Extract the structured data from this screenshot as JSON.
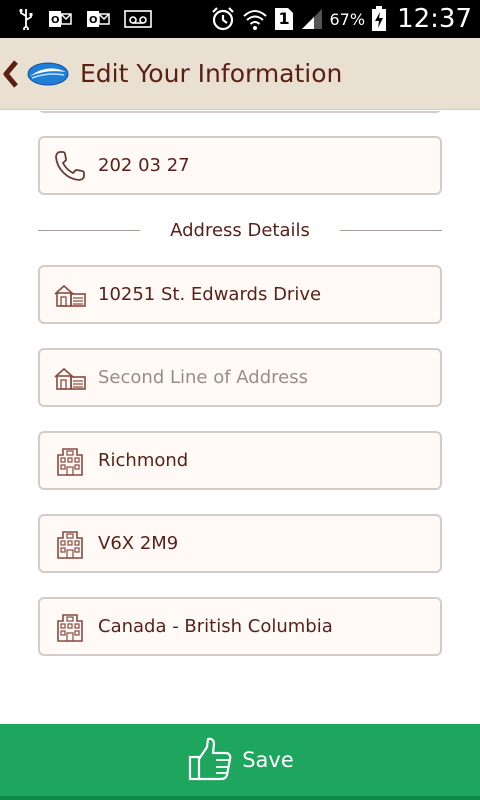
{
  "status_bar": {
    "battery": "67%",
    "time": "12:37",
    "sim_slot": "1",
    "icons": [
      "usb-icon",
      "outlook-icon",
      "outlook-icon",
      "voicemail-icon",
      "alarm-icon",
      "wifi-icon",
      "sim-icon",
      "signal-icon",
      "battery-charging-icon"
    ]
  },
  "header": {
    "title": "Edit Your Information",
    "back_icon": "back-chevron-icon",
    "logo_icon": "brand-logo-icon"
  },
  "fields": {
    "phone": {
      "value": "202 03 27",
      "icon": "phone-icon"
    }
  },
  "address_section": {
    "title": "Address Details",
    "fields": [
      {
        "name": "address-line-1",
        "value": "10251 St. Edwards Drive",
        "placeholder": "",
        "icon": "house-icon"
      },
      {
        "name": "address-line-2",
        "value": "",
        "placeholder": "Second Line of Address",
        "icon": "house-icon"
      },
      {
        "name": "city",
        "value": "Richmond",
        "placeholder": "",
        "icon": "building-icon"
      },
      {
        "name": "postal-code",
        "value": "V6X 2M9",
        "placeholder": "",
        "icon": "building-icon"
      },
      {
        "name": "province",
        "value": "Canada - British Columbia",
        "placeholder": "",
        "icon": "building-icon"
      }
    ]
  },
  "save_button": {
    "label": "Save",
    "icon": "thumbs-up-icon"
  },
  "colors": {
    "header_bg": "#e9e0d1",
    "title_text": "#5c1f14",
    "field_border": "#d4ccc8",
    "field_bg": "#fffaf6",
    "save_bg": "#1ea55e",
    "logo_blue": "#1f7fd6"
  }
}
